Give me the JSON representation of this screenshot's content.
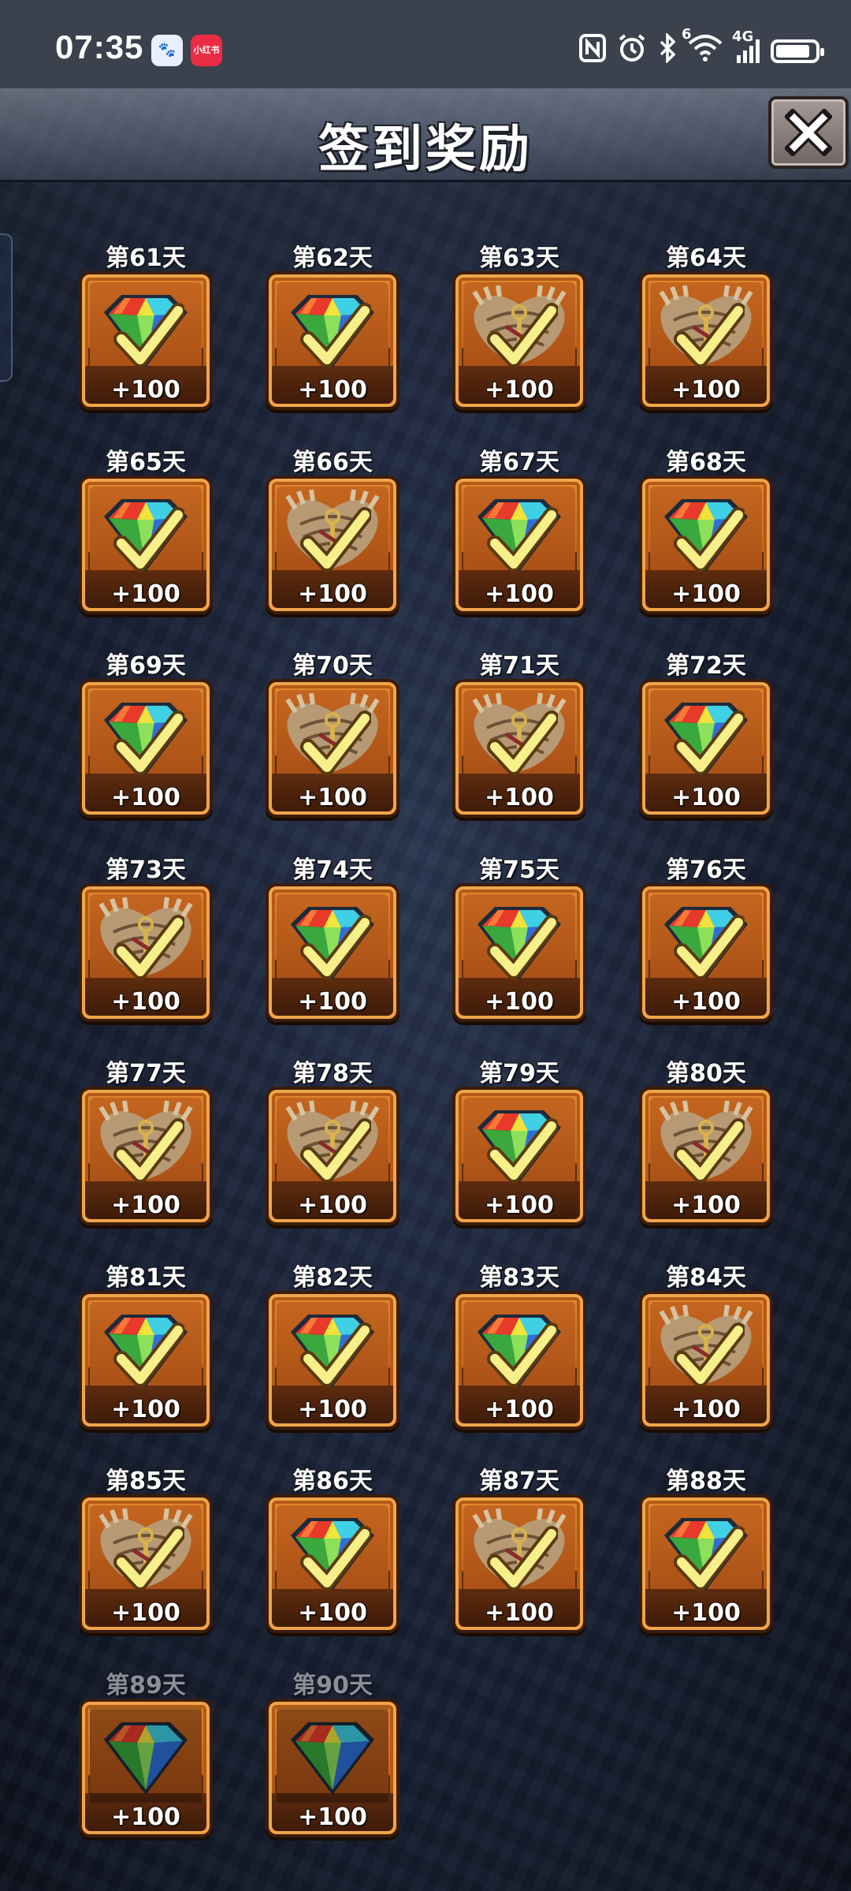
{
  "status_bar": {
    "time": "07:35",
    "baidu_badge": "🐾",
    "xhs_badge": "小红书",
    "icons": [
      "nfc-icon",
      "alarm-icon",
      "bluetooth-icon",
      "wifi-icon",
      "signal-4g-icon",
      "battery-icon"
    ],
    "network_label": "4G",
    "wifi_sup": "6"
  },
  "header": {
    "title": "签到奖励"
  },
  "colors": {
    "tile_orange": "#e08a2e",
    "tile_dark": "#3e1b08",
    "check_yellow": "#f7ef8a"
  },
  "days": [
    {
      "label": "第61天",
      "reward": "gem",
      "amount": "+100",
      "claimed": true
    },
    {
      "label": "第62天",
      "reward": "gem",
      "amount": "+100",
      "claimed": true
    },
    {
      "label": "第63天",
      "reward": "emblem",
      "amount": "+100",
      "claimed": true
    },
    {
      "label": "第64天",
      "reward": "emblem",
      "amount": "+100",
      "claimed": true
    },
    {
      "label": "第65天",
      "reward": "gem",
      "amount": "+100",
      "claimed": true
    },
    {
      "label": "第66天",
      "reward": "emblem",
      "amount": "+100",
      "claimed": true
    },
    {
      "label": "第67天",
      "reward": "gem",
      "amount": "+100",
      "claimed": true
    },
    {
      "label": "第68天",
      "reward": "gem",
      "amount": "+100",
      "claimed": true
    },
    {
      "label": "第69天",
      "reward": "gem",
      "amount": "+100",
      "claimed": true
    },
    {
      "label": "第70天",
      "reward": "emblem",
      "amount": "+100",
      "claimed": true
    },
    {
      "label": "第71天",
      "reward": "emblem",
      "amount": "+100",
      "claimed": true
    },
    {
      "label": "第72天",
      "reward": "gem",
      "amount": "+100",
      "claimed": true
    },
    {
      "label": "第73天",
      "reward": "emblem",
      "amount": "+100",
      "claimed": true
    },
    {
      "label": "第74天",
      "reward": "gem",
      "amount": "+100",
      "claimed": true
    },
    {
      "label": "第75天",
      "reward": "gem",
      "amount": "+100",
      "claimed": true
    },
    {
      "label": "第76天",
      "reward": "gem",
      "amount": "+100",
      "claimed": true
    },
    {
      "label": "第77天",
      "reward": "emblem",
      "amount": "+100",
      "claimed": true
    },
    {
      "label": "第78天",
      "reward": "emblem",
      "amount": "+100",
      "claimed": true
    },
    {
      "label": "第79天",
      "reward": "gem",
      "amount": "+100",
      "claimed": true
    },
    {
      "label": "第80天",
      "reward": "emblem",
      "amount": "+100",
      "claimed": true
    },
    {
      "label": "第81天",
      "reward": "gem",
      "amount": "+100",
      "claimed": true
    },
    {
      "label": "第82天",
      "reward": "gem",
      "amount": "+100",
      "claimed": true
    },
    {
      "label": "第83天",
      "reward": "gem",
      "amount": "+100",
      "claimed": true
    },
    {
      "label": "第84天",
      "reward": "emblem",
      "amount": "+100",
      "claimed": true
    },
    {
      "label": "第85天",
      "reward": "emblem",
      "amount": "+100",
      "claimed": true
    },
    {
      "label": "第86天",
      "reward": "gem",
      "amount": "+100",
      "claimed": true
    },
    {
      "label": "第87天",
      "reward": "emblem",
      "amount": "+100",
      "claimed": true
    },
    {
      "label": "第88天",
      "reward": "gem",
      "amount": "+100",
      "claimed": true
    },
    {
      "label": "第89天",
      "reward": "gem",
      "amount": "+100",
      "claimed": false
    },
    {
      "label": "第90天",
      "reward": "gem",
      "amount": "+100",
      "claimed": false
    }
  ]
}
